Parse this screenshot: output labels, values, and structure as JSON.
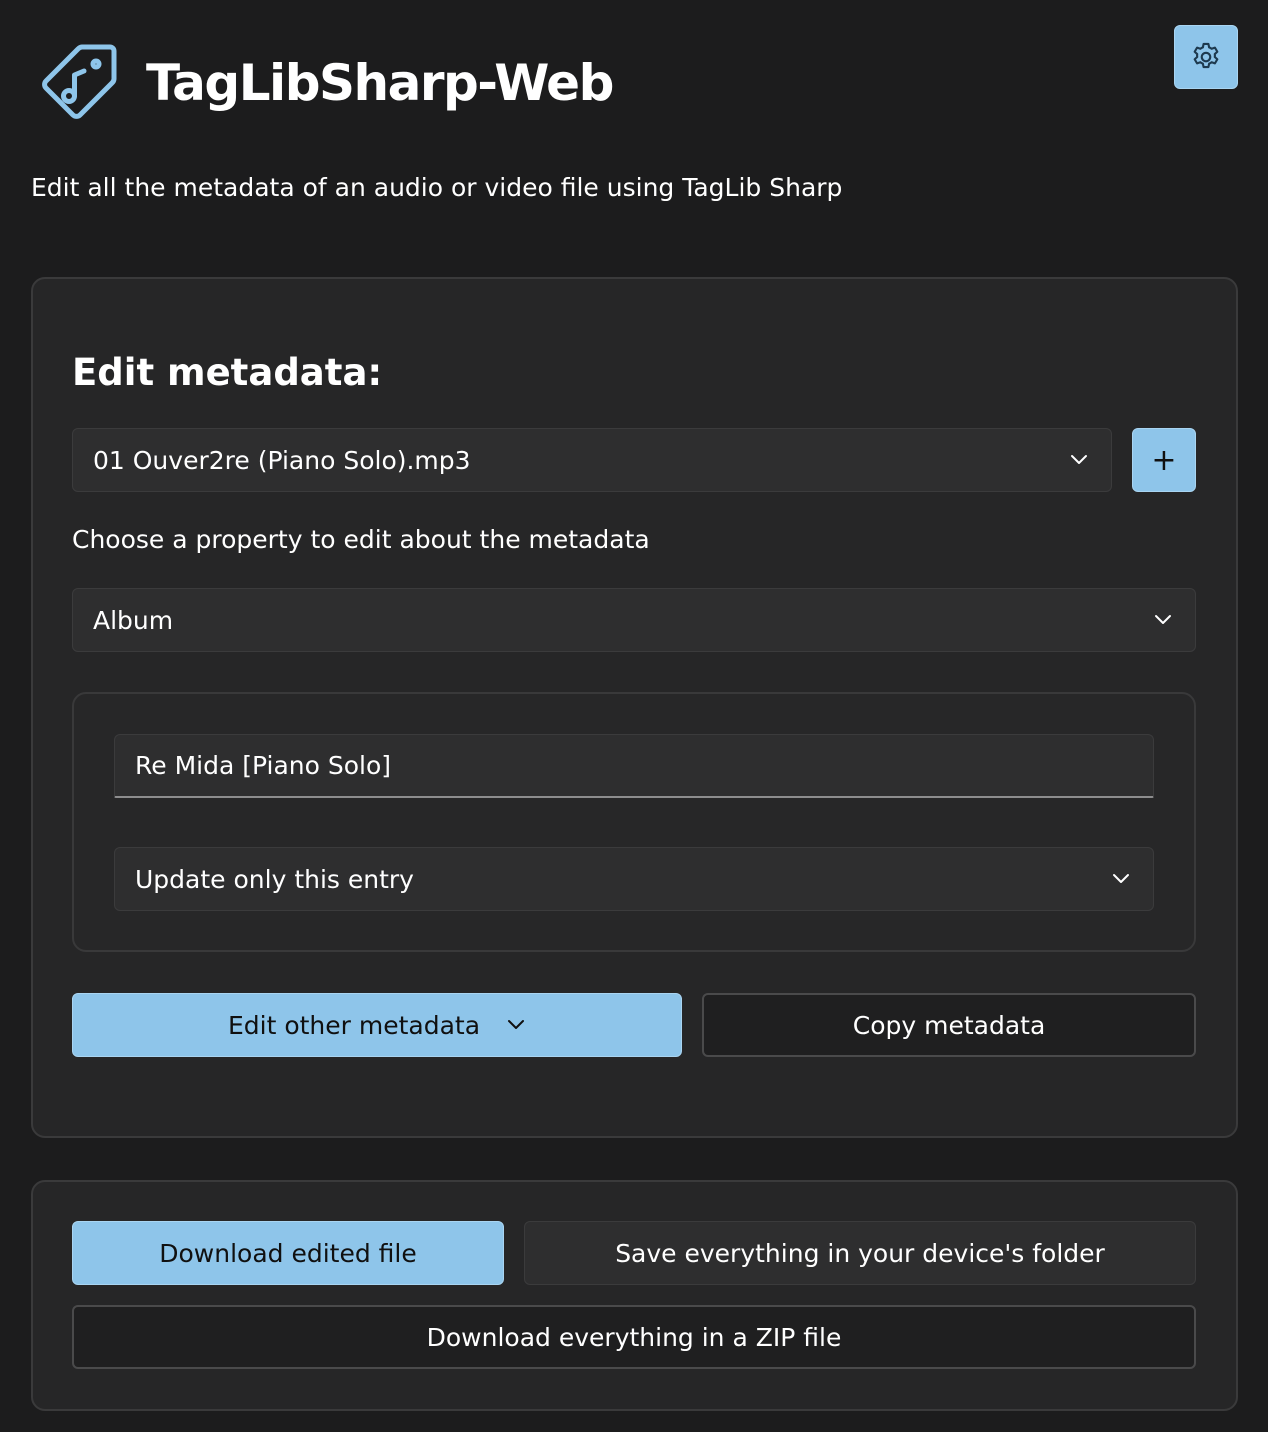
{
  "header": {
    "app_title": "TagLibSharp-Web",
    "logo_icon": "music-tag-icon",
    "settings_icon": "gear-icon",
    "tagline": "Edit all the metadata of an audio or video file using TagLib Sharp"
  },
  "edit_card": {
    "title": "Edit metadata:",
    "file_select": {
      "selected": "01 Ouver2re (Piano Solo).mp3",
      "icon": "chevron-down-icon"
    },
    "add_button_label": "+",
    "property_hint": "Choose a property to edit about the metadata",
    "property_select": {
      "selected": "Album",
      "icon": "chevron-down-icon"
    },
    "value_input": {
      "value": "Re Mida [Piano Solo]"
    },
    "scope_select": {
      "selected": "Update only this entry",
      "icon": "chevron-down-icon"
    },
    "edit_other_label": "Edit other metadata",
    "copy_label": "Copy metadata"
  },
  "download_card": {
    "download_edited_label": "Download edited file",
    "save_folder_label": "Save everything in your device's folder",
    "download_zip_label": "Download everything in a ZIP file"
  },
  "colors": {
    "background": "#1c1c1d",
    "card": "#262627",
    "accent": "#8ec5ea",
    "logo_stroke": "#8ec5ea"
  }
}
